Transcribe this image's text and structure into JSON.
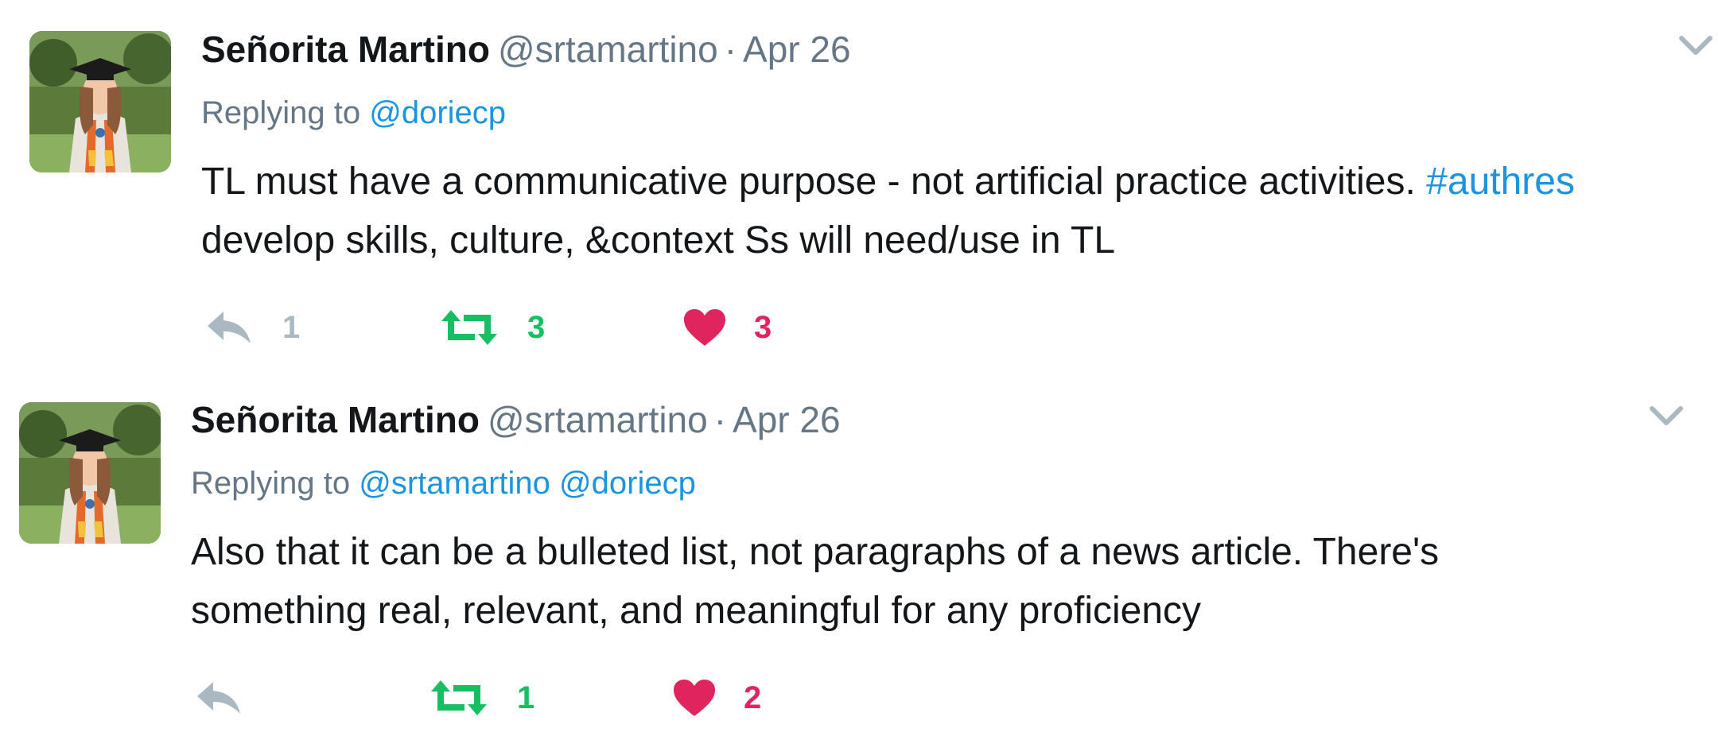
{
  "tweets": [
    {
      "name": "Señorita Martino",
      "handle": "@srtamartino",
      "separator": "·",
      "date": "Apr 26",
      "replying_label": "Replying to",
      "replying_to": [
        "@doriecp"
      ],
      "text_lines": [
        {
          "plain": "TL must have a communicative purpose - not artificial practice activities. ",
          "tag": "#authres"
        },
        {
          "plain": "develop skills, culture, &context Ss will need/use in TL",
          "tag": ""
        }
      ],
      "reply_count": "1",
      "retweet_count": "3",
      "like_count": "3",
      "icons": {
        "reply": "reply-icon",
        "retweet": "retweet-icon",
        "like": "heart-icon",
        "menu": "chevron-down-icon"
      }
    },
    {
      "name": "Señorita Martino",
      "handle": "@srtamartino",
      "separator": "·",
      "date": "Apr 26",
      "replying_label": "Replying to",
      "replying_to": [
        "@srtamartino",
        "@doriecp"
      ],
      "text_lines": [
        {
          "plain": "Also that it can be a bulleted list, not paragraphs of a news article. There's",
          "tag": ""
        },
        {
          "plain": "something real, relevant, and meaningful for any proficiency",
          "tag": ""
        }
      ],
      "reply_count": "",
      "retweet_count": "1",
      "like_count": "2",
      "icons": {
        "reply": "reply-icon",
        "retweet": "retweet-icon",
        "like": "heart-icon",
        "menu": "chevron-down-icon"
      }
    }
  ],
  "colors": {
    "text": "#14171a",
    "muted": "#657786",
    "link": "#1b95e0",
    "retweet": "#17bf63",
    "like": "#e0245e",
    "reply_icon": "#aab8c2"
  }
}
